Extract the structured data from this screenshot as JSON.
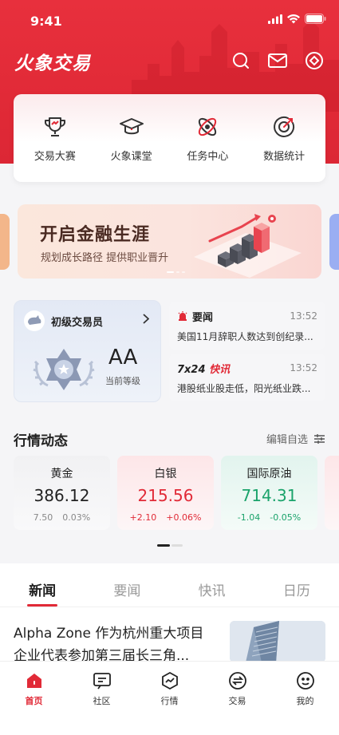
{
  "status_bar": {
    "time": "9:41"
  },
  "app": {
    "title": "火象交易"
  },
  "header_actions": [
    {
      "name": "search-icon"
    },
    {
      "name": "mail-icon"
    },
    {
      "name": "settings-icon"
    }
  ],
  "quick_entries": [
    {
      "label": "交易大赛",
      "icon": "trophy-icon"
    },
    {
      "label": "火象课堂",
      "icon": "graduation-cap-icon"
    },
    {
      "label": "任务中心",
      "icon": "task-icon"
    },
    {
      "label": "数据统计",
      "icon": "target-icon"
    }
  ],
  "banner": {
    "title": "开启金融生涯",
    "subtitle": "规划成长路径  提供职业晋升"
  },
  "trader": {
    "title": "初级交易员",
    "level": "AA",
    "level_label": "当前等级"
  },
  "news_cards": [
    {
      "tag": "要闻",
      "time": "13:52",
      "text": "美国11月辞职人数达到创纪录..."
    },
    {
      "tag_prefix": "7x24",
      "tag_suffix": "快讯",
      "time": "13:52",
      "text": "港股纸业股走低，阳光纸业跌..."
    }
  ],
  "market": {
    "title": "行情动态",
    "edit_label": "编辑自选",
    "quotes": [
      {
        "name": "黄金",
        "price": "386.12",
        "change": "7.50",
        "change_pct": "0.03%",
        "trend": "neutral"
      },
      {
        "name": "白银",
        "price": "215.56",
        "change": "+2.10",
        "change_pct": "+0.06%",
        "trend": "up"
      },
      {
        "name": "国际原油",
        "price": "714.31",
        "change": "-1.04",
        "change_pct": "-0.05%",
        "trend": "down"
      }
    ]
  },
  "news_tabs": [
    "新闻",
    "要闻",
    "快讯",
    "日历"
  ],
  "article": {
    "title": "Alpha Zone 作为杭州重大项目企业代表参加第三届长三角..."
  },
  "bottom_nav": [
    {
      "label": "首页",
      "icon": "home-icon",
      "active": true
    },
    {
      "label": "社区",
      "icon": "community-icon",
      "active": false
    },
    {
      "label": "行情",
      "icon": "market-icon",
      "active": false
    },
    {
      "label": "交易",
      "icon": "trade-icon",
      "active": false
    },
    {
      "label": "我的",
      "icon": "profile-icon",
      "active": false
    }
  ],
  "colors": {
    "brand_red": "#e12a37",
    "up": "#e12a37",
    "down": "#1aa36b"
  }
}
